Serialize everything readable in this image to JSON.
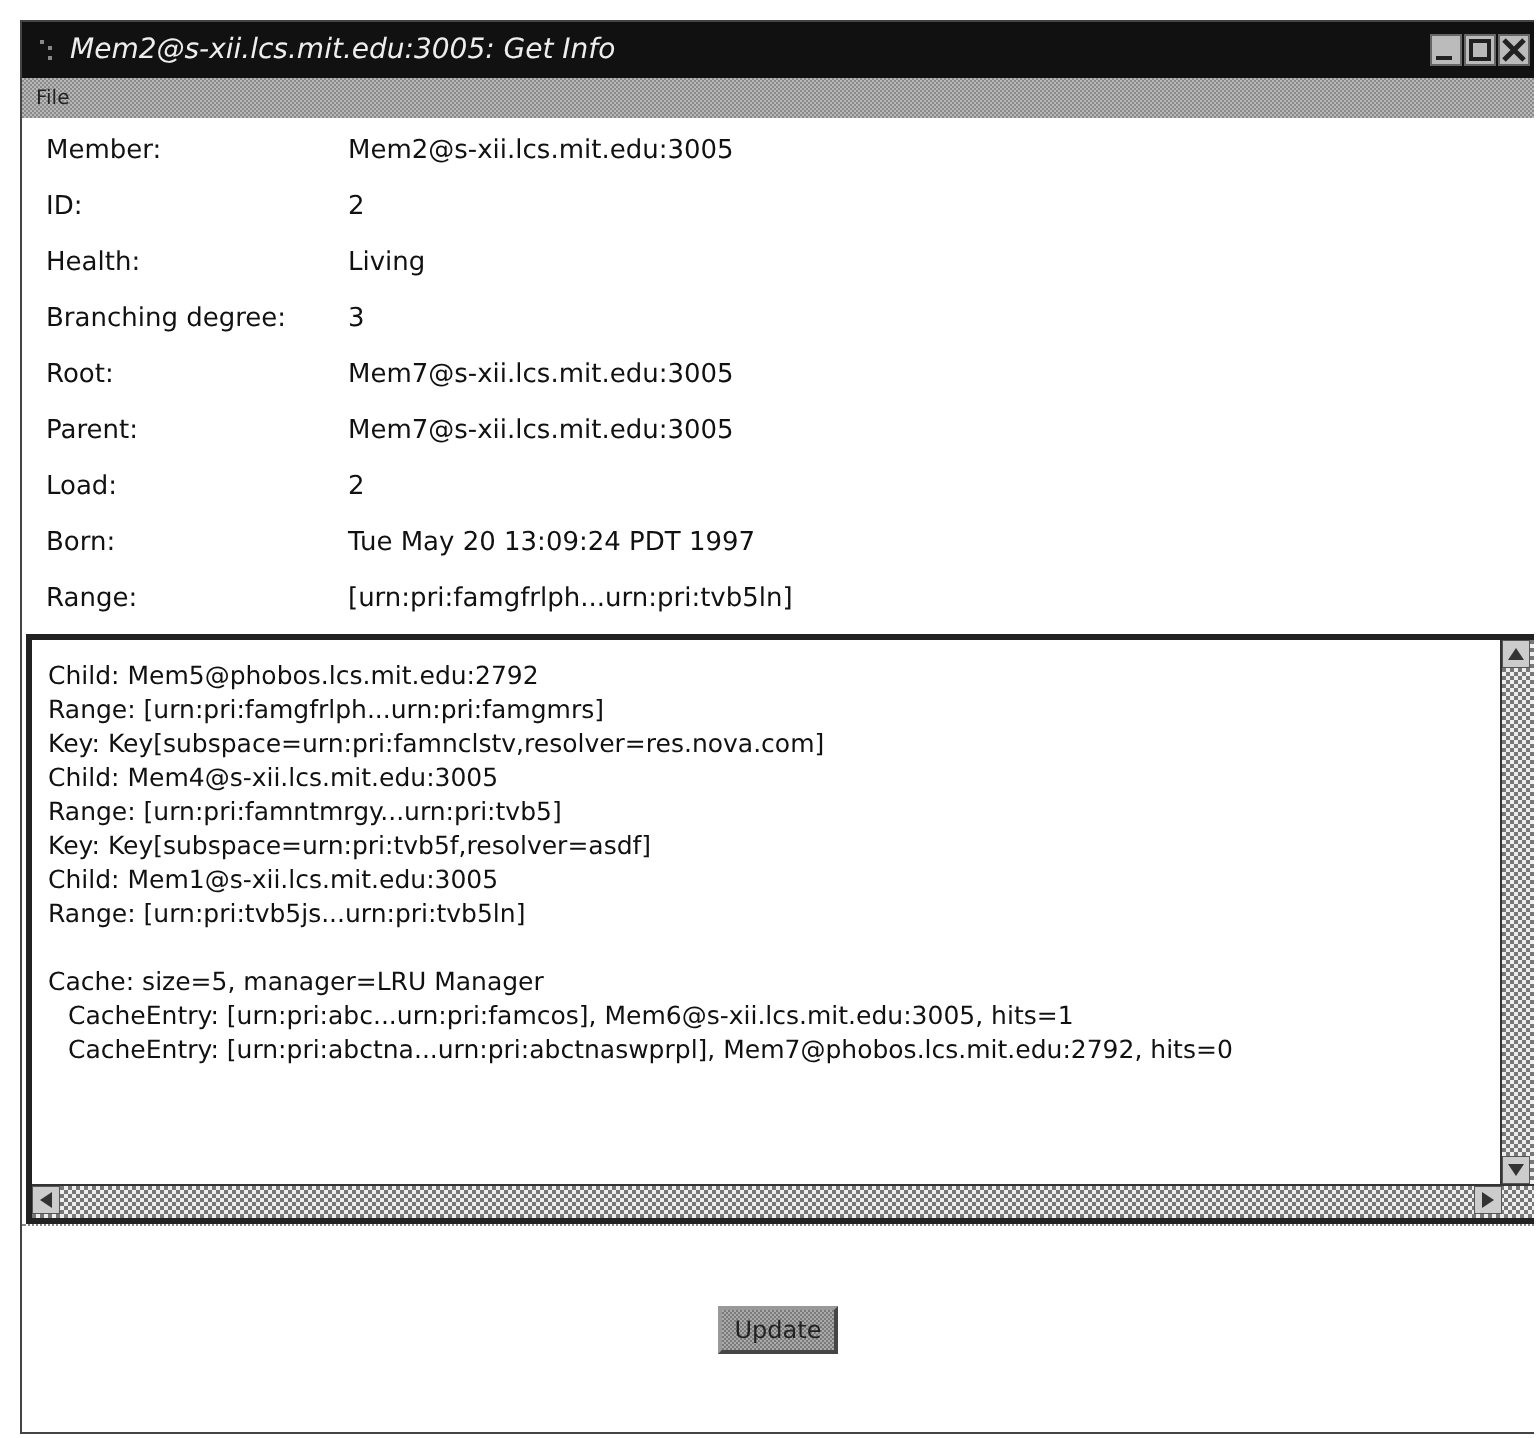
{
  "window": {
    "title": "Mem2@s-xii.lcs.mit.edu:3005: Get Info"
  },
  "menu": [
    "File"
  ],
  "fields": [
    {
      "label": "Member:",
      "value": "Mem2@s-xii.lcs.mit.edu:3005"
    },
    {
      "label": "ID:",
      "value": "2"
    },
    {
      "label": "Health:",
      "value": "Living"
    },
    {
      "label": "Branching degree:",
      "value": "3"
    },
    {
      "label": "Root:",
      "value": "Mem7@s-xii.lcs.mit.edu:3005"
    },
    {
      "label": "Parent:",
      "value": "Mem7@s-xii.lcs.mit.edu:3005"
    },
    {
      "label": "Load:",
      "value": "2"
    },
    {
      "label": "Born:",
      "value": "Tue May 20 13:09:24 PDT 1997"
    },
    {
      "label": "Range:",
      "value": "[urn:pri:famgfrlph...urn:pri:tvb5ln]"
    }
  ],
  "details": {
    "children_lines": [
      "Child: Mem5@phobos.lcs.mit.edu:2792",
      "Range: [urn:pri:famgfrlph...urn:pri:famgmrs]",
      "Key: Key[subspace=urn:pri:famnclstv,resolver=res.nova.com]",
      "Child: Mem4@s-xii.lcs.mit.edu:3005",
      "Range: [urn:pri:famntmrgy...urn:pri:tvb5]",
      "Key: Key[subspace=urn:pri:tvb5f,resolver=asdf]",
      "Child: Mem1@s-xii.lcs.mit.edu:3005",
      "Range: [urn:pri:tvb5js...urn:pri:tvb5ln]"
    ],
    "cache": {
      "text": "Cache: size=5, manager=LRU Manager",
      "children": [
        "CacheEntry: [urn:pri:abc...urn:pri:famcos], Mem6@s-xii.lcs.mit.edu:3005, hits=1",
        "CacheEntry: [urn:pri:abctna...urn:pri:abctnaswprpl], Mem7@phobos.lcs.mit.edu:2792, hits=0"
      ]
    }
  },
  "buttons": [
    "Update"
  ]
}
